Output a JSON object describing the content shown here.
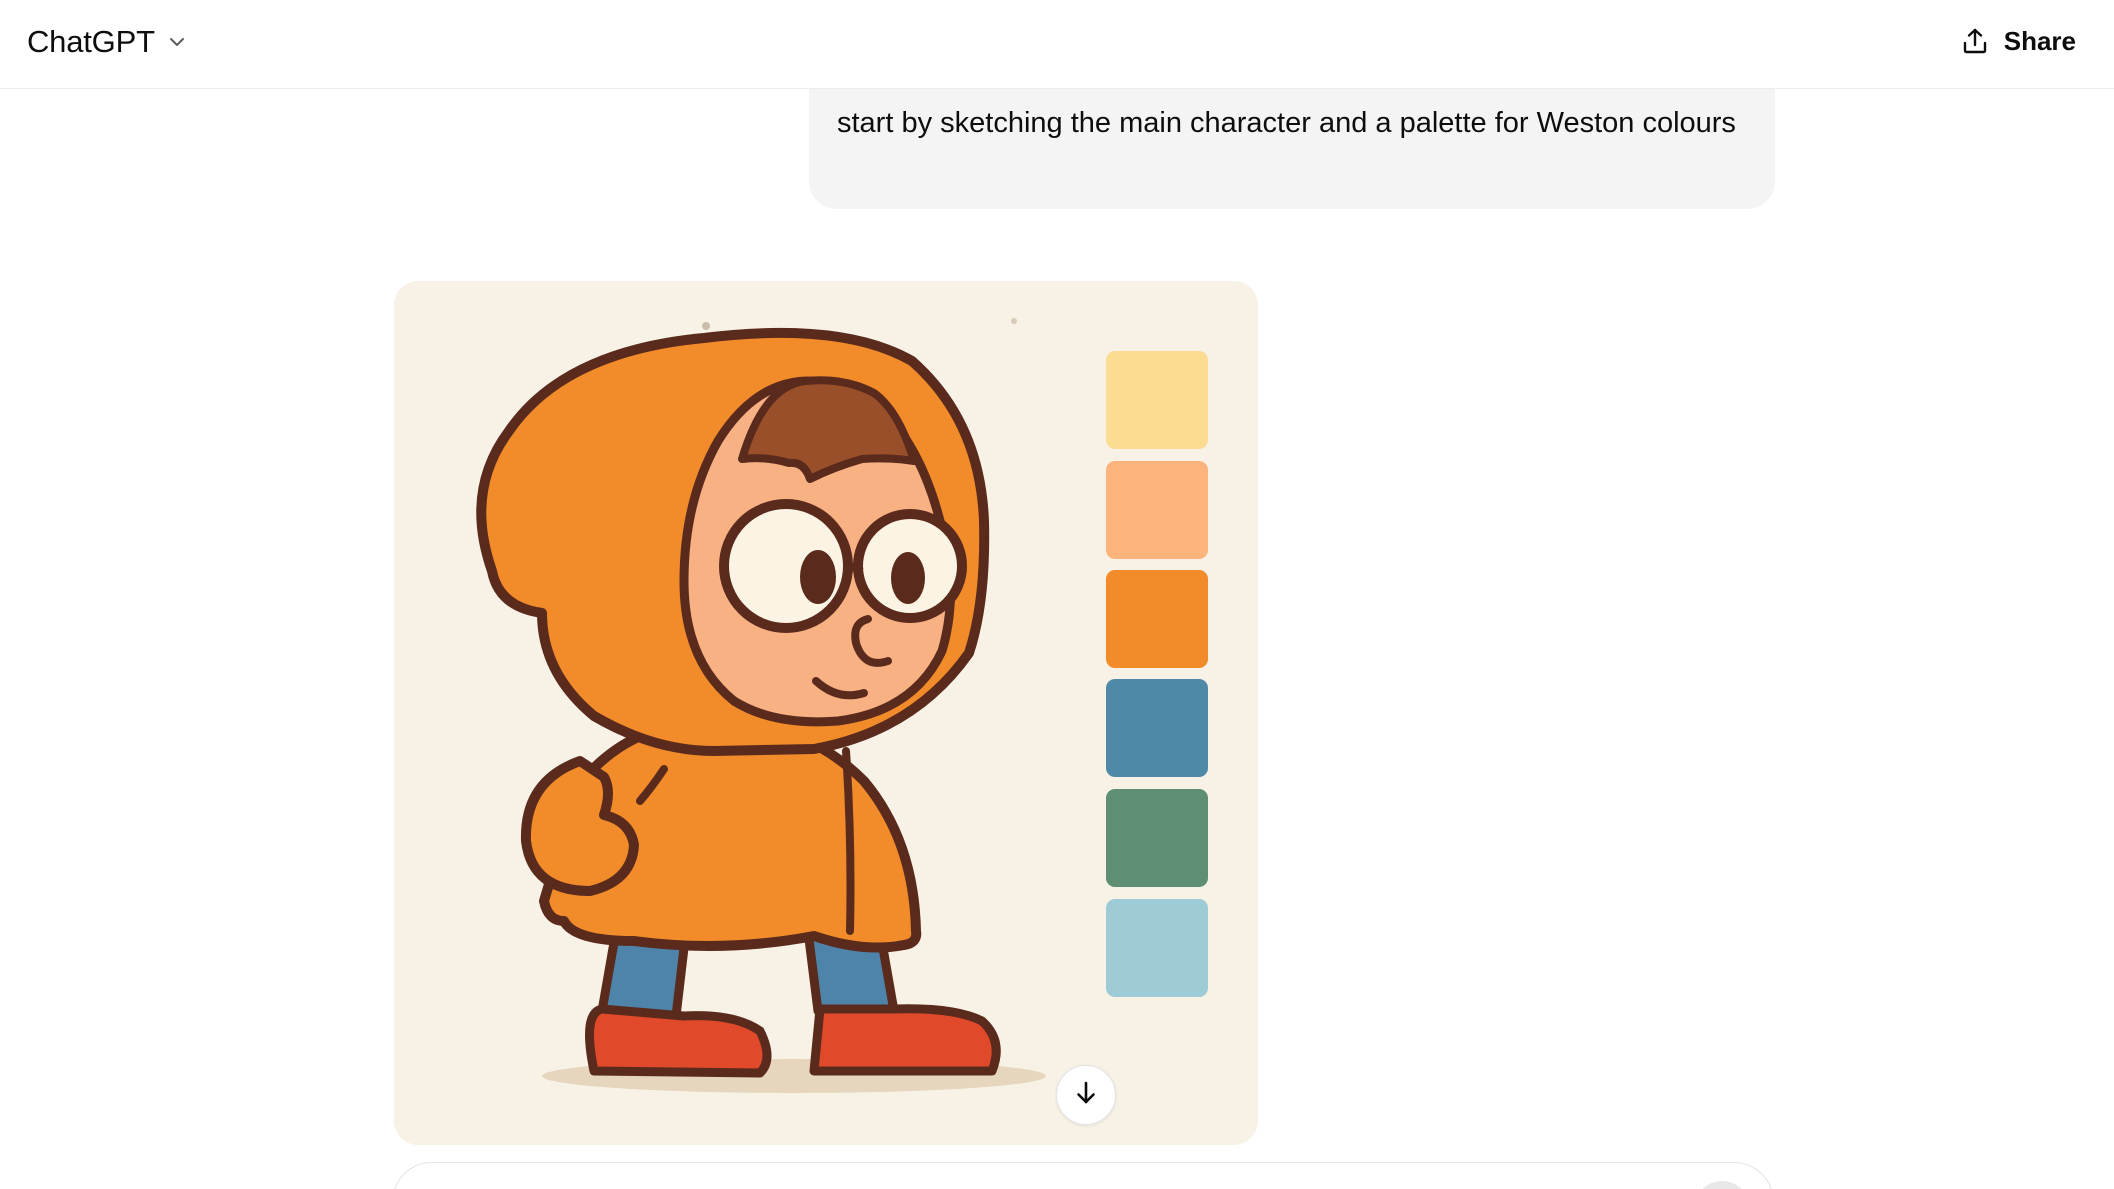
{
  "header": {
    "model_name": "ChatGPT",
    "model_menu_icon": "chevron-down-icon",
    "share_label": "Share",
    "share_icon": "share-upload-icon"
  },
  "conversation": {
    "user_message": "start by sketching the main character and a palette for Weston colours",
    "assistant_image": {
      "description_icon": "generated-image",
      "palette": [
        "#fcdc92",
        "#fcb47c",
        "#f28b2a",
        "#5089a8",
        "#5e8f74",
        "#9dcbd6"
      ],
      "download_icon": "arrow-down-icon"
    }
  },
  "composer": {
    "send_icon": "send-icon"
  }
}
